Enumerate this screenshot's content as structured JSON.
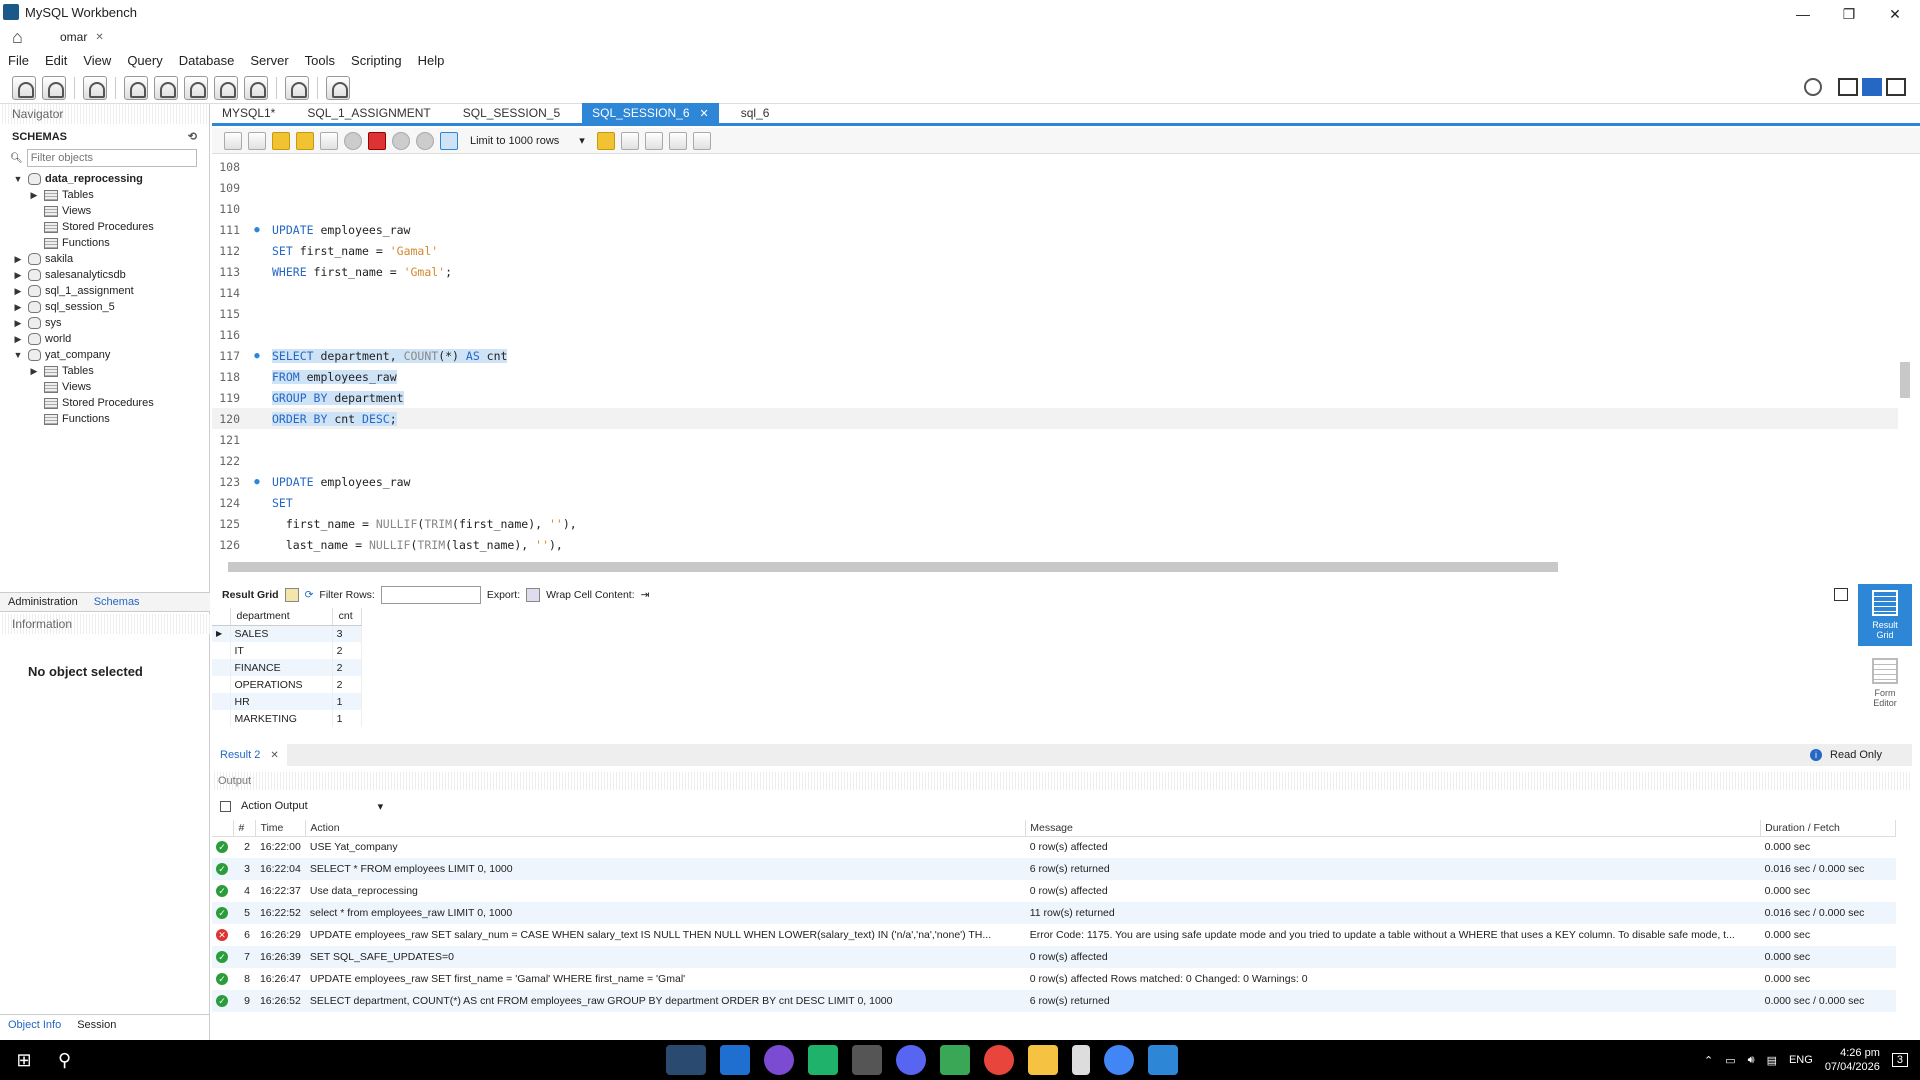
{
  "window": {
    "title": "MySQL Workbench",
    "minimize": "—",
    "restore": "❐",
    "close": "✕"
  },
  "connection_tab": {
    "label": "omar",
    "close": "✕"
  },
  "menu": [
    "File",
    "Edit",
    "View",
    "Query",
    "Database",
    "Server",
    "Tools",
    "Scripting",
    "Help"
  ],
  "navigator": {
    "title": "Navigator",
    "schemas_label": "SCHEMAS",
    "filter_placeholder": "Filter objects",
    "tree": [
      {
        "label": "data_reprocessing",
        "expanded": true,
        "bold": true,
        "level": 0,
        "twist": "▼",
        "icon": "db"
      },
      {
        "label": "Tables",
        "level": 1,
        "twist": "▶",
        "icon": "folder"
      },
      {
        "label": "Views",
        "level": 1,
        "twist": "",
        "icon": "folder"
      },
      {
        "label": "Stored Procedures",
        "level": 1,
        "twist": "",
        "icon": "folder"
      },
      {
        "label": "Functions",
        "level": 1,
        "twist": "",
        "icon": "folder"
      },
      {
        "label": "sakila",
        "level": 0,
        "twist": "▶",
        "icon": "db"
      },
      {
        "label": "salesanalyticsdb",
        "level": 0,
        "twist": "▶",
        "icon": "db"
      },
      {
        "label": "sql_1_assignment",
        "level": 0,
        "twist": "▶",
        "icon": "db"
      },
      {
        "label": "sql_session_5",
        "level": 0,
        "twist": "▶",
        "icon": "db"
      },
      {
        "label": "sys",
        "level": 0,
        "twist": "▶",
        "icon": "db"
      },
      {
        "label": "world",
        "level": 0,
        "twist": "▶",
        "icon": "db"
      },
      {
        "label": "yat_company",
        "level": 0,
        "twist": "▼",
        "icon": "db"
      },
      {
        "label": "Tables",
        "level": 1,
        "twist": "▶",
        "icon": "folder"
      },
      {
        "label": "Views",
        "level": 1,
        "twist": "",
        "icon": "folder"
      },
      {
        "label": "Stored Procedures",
        "level": 1,
        "twist": "",
        "icon": "folder"
      },
      {
        "label": "Functions",
        "level": 1,
        "twist": "",
        "icon": "folder"
      }
    ],
    "side_tabs": [
      "Administration",
      "Schemas"
    ],
    "information_title": "Information",
    "no_object": "No object selected",
    "bottom_tabs": [
      "Object Info",
      "Session"
    ]
  },
  "editor_tabs": [
    {
      "label": "MYSQL1*",
      "active": false
    },
    {
      "label": "SQL_1_ASSIGNMENT",
      "active": false
    },
    {
      "label": "SQL_SESSION_5",
      "active": false
    },
    {
      "label": "SQL_SESSION_6",
      "active": true,
      "close": "✕"
    },
    {
      "label": "sql_6",
      "active": false
    }
  ],
  "sql_toolbar": {
    "limit_label": "Limit to 1000 rows",
    "limit_arrow": "▾"
  },
  "editor_lines": [
    {
      "n": "108",
      "dot": false,
      "tokens": []
    },
    {
      "n": "109",
      "dot": false,
      "tokens": []
    },
    {
      "n": "110",
      "dot": false,
      "tokens": []
    },
    {
      "n": "111",
      "dot": true,
      "tokens": [
        [
          "kw",
          "UPDATE"
        ],
        [
          "t",
          " employees_raw"
        ]
      ]
    },
    {
      "n": "112",
      "dot": false,
      "tokens": [
        [
          "kw",
          "SET"
        ],
        [
          "t",
          " first_name = "
        ],
        [
          "str",
          "'Gamal'"
        ]
      ]
    },
    {
      "n": "113",
      "dot": false,
      "tokens": [
        [
          "kw",
          "WHERE"
        ],
        [
          "t",
          " first_name = "
        ],
        [
          "str",
          "'Gmal'"
        ],
        [
          "t",
          ";"
        ]
      ]
    },
    {
      "n": "114",
      "dot": false,
      "tokens": []
    },
    {
      "n": "115",
      "dot": false,
      "tokens": []
    },
    {
      "n": "116",
      "dot": false,
      "tokens": []
    },
    {
      "n": "117",
      "dot": true,
      "hl": true,
      "tokens": [
        [
          "kw",
          "SELECT"
        ],
        [
          "t",
          " department, "
        ],
        [
          "fn",
          "COUNT"
        ],
        [
          "t",
          "(*) "
        ],
        [
          "kw",
          "AS"
        ],
        [
          "t",
          " cnt"
        ]
      ]
    },
    {
      "n": "118",
      "dot": false,
      "hl": true,
      "tokens": [
        [
          "kw",
          "FROM"
        ],
        [
          "t",
          " employees_raw"
        ]
      ]
    },
    {
      "n": "119",
      "dot": false,
      "hl": true,
      "tokens": [
        [
          "kw",
          "GROUP BY"
        ],
        [
          "t",
          " department"
        ]
      ]
    },
    {
      "n": "120",
      "dot": false,
      "hl": true,
      "cur": true,
      "tokens": [
        [
          "kw",
          "ORDER BY"
        ],
        [
          "t",
          " cnt "
        ],
        [
          "kw",
          "DESC"
        ],
        [
          "t",
          ";"
        ]
      ]
    },
    {
      "n": "121",
      "dot": false,
      "tokens": []
    },
    {
      "n": "122",
      "dot": false,
      "tokens": []
    },
    {
      "n": "123",
      "dot": true,
      "tokens": [
        [
          "kw",
          "UPDATE"
        ],
        [
          "t",
          " employees_raw"
        ]
      ]
    },
    {
      "n": "124",
      "dot": false,
      "tokens": [
        [
          "kw",
          "SET"
        ]
      ]
    },
    {
      "n": "125",
      "dot": false,
      "tokens": [
        [
          "t",
          "  first_name = "
        ],
        [
          "fn",
          "NULLIF"
        ],
        [
          "t",
          "("
        ],
        [
          "fn",
          "TRIM"
        ],
        [
          "t",
          "(first_name), "
        ],
        [
          "str",
          "''"
        ],
        [
          "t",
          "),"
        ]
      ]
    },
    {
      "n": "126",
      "dot": false,
      "tokens": [
        [
          "t",
          "  last_name = "
        ],
        [
          "fn",
          "NULLIF"
        ],
        [
          "t",
          "("
        ],
        [
          "fn",
          "TRIM"
        ],
        [
          "t",
          "(last_name), "
        ],
        [
          "str",
          "''"
        ],
        [
          "t",
          "),"
        ]
      ]
    }
  ],
  "result_toolbar": {
    "result_grid": "Result Grid",
    "filter_rows": "Filter Rows:",
    "export": "Export:",
    "wrap": "Wrap Cell Content:"
  },
  "result_grid": {
    "columns": [
      "department",
      "cnt"
    ],
    "rows": [
      [
        "SALES",
        "3"
      ],
      [
        "IT",
        "2"
      ],
      [
        "FINANCE",
        "2"
      ],
      [
        "OPERATIONS",
        "2"
      ],
      [
        "HR",
        "1"
      ],
      [
        "MARKETING",
        "1"
      ]
    ]
  },
  "side_buttons": [
    {
      "label1": "Result",
      "label2": "Grid",
      "active": true
    },
    {
      "label1": "Form",
      "label2": "Editor",
      "active": false
    }
  ],
  "result_tab": {
    "label": "Result 2",
    "close": "✕",
    "read_only": "Read Only",
    "info": "i"
  },
  "output": {
    "title": "Output",
    "selector": "Action Output",
    "selector_arrow": "▾",
    "columns": [
      "",
      "#",
      "Time",
      "Action",
      "Message",
      "Duration / Fetch"
    ],
    "rows": [
      {
        "status": "ok",
        "n": "2",
        "time": "16:22:00",
        "action": "USE Yat_company",
        "message": "0 row(s) affected",
        "duration": "0.000 sec"
      },
      {
        "status": "ok",
        "n": "3",
        "time": "16:22:04",
        "action": "SELECT * FROM employees LIMIT 0, 1000",
        "message": "6 row(s) returned",
        "duration": "0.016 sec / 0.000 sec"
      },
      {
        "status": "ok",
        "n": "4",
        "time": "16:22:37",
        "action": "Use data_reprocessing",
        "message": "0 row(s) affected",
        "duration": "0.000 sec"
      },
      {
        "status": "ok",
        "n": "5",
        "time": "16:22:52",
        "action": "select * from employees_raw LIMIT 0, 1000",
        "message": "11 row(s) returned",
        "duration": "0.016 sec / 0.000 sec"
      },
      {
        "status": "err",
        "n": "6",
        "time": "16:26:29",
        "action": "UPDATE employees_raw SET salary_num = CASE     WHEN salary_text IS NULL THEN NULL     WHEN LOWER(salary_text) IN ('n/a','na','none') TH...",
        "message": "Error Code: 1175. You are using safe update mode and you tried to update a table without a WHERE that uses a KEY column.  To disable safe mode, t...",
        "duration": "0.000 sec"
      },
      {
        "status": "ok",
        "n": "7",
        "time": "16:26:39",
        "action": "SET  SQL_SAFE_UPDATES=0",
        "message": "0 row(s) affected",
        "duration": "0.000 sec"
      },
      {
        "status": "ok",
        "n": "8",
        "time": "16:26:47",
        "action": "UPDATE employees_raw SET first_name = 'Gamal' WHERE first_name = 'Gmal'",
        "message": "0 row(s) affected Rows matched: 0  Changed: 0  Warnings: 0",
        "duration": "0.000 sec"
      },
      {
        "status": "ok",
        "n": "9",
        "time": "16:26:52",
        "action": "SELECT department, COUNT(*) AS cnt FROM employees_raw GROUP BY department ORDER BY cnt DESC LIMIT 0, 1000",
        "message": "6 row(s) returned",
        "duration": "0.000 sec / 0.000 sec"
      }
    ]
  },
  "taskbar": {
    "lang": "ENG",
    "time": "4:26 pm",
    "date": "07/04/2026",
    "notif": "3"
  }
}
